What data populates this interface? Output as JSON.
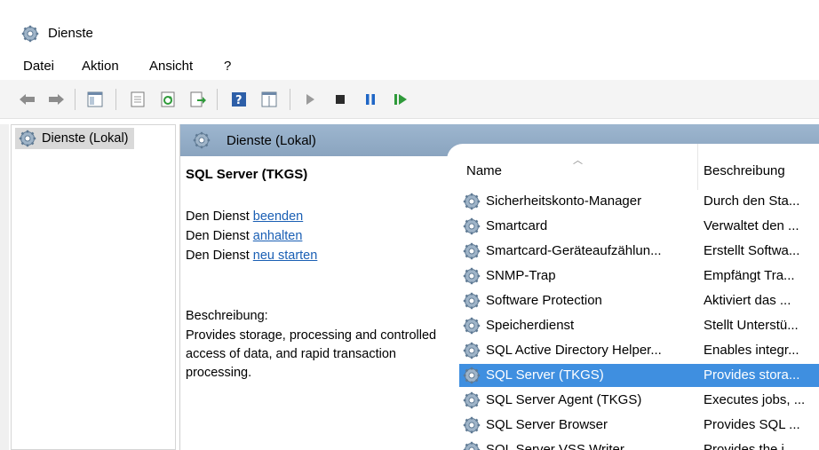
{
  "window": {
    "title": "Dienste"
  },
  "menu": [
    "Datei",
    "Aktion",
    "Ansicht",
    "?"
  ],
  "toolbar": {
    "icons": [
      "back-arrow-icon",
      "forward-arrow-icon",
      "show-hide-console-tree-icon",
      "properties-icon",
      "refresh-icon",
      "export-list-icon",
      "help-icon",
      "extended-view-icon",
      "start-service-icon",
      "stop-service-icon",
      "pause-service-icon",
      "resume-service-icon"
    ]
  },
  "tree": {
    "item": "Dienste (Lokal)"
  },
  "panel": {
    "header": "Dienste (Lokal)"
  },
  "detail": {
    "service_name": "SQL Server (TKGS)",
    "actions": [
      {
        "prefix": "Den Dienst ",
        "link": "beenden"
      },
      {
        "prefix": "Den Dienst ",
        "link": "anhalten"
      },
      {
        "prefix": "Den Dienst ",
        "link": "neu starten"
      }
    ],
    "description_label": "Beschreibung:",
    "description": "Provides storage, processing and controlled access of data, and rapid transaction processing."
  },
  "list": {
    "columns": {
      "name": "Name",
      "description": "Beschreibung"
    },
    "rows": [
      {
        "name": "Sicherheitskonto-Manager",
        "desc": "Durch den Sta..."
      },
      {
        "name": "Smartcard",
        "desc": "Verwaltet den ..."
      },
      {
        "name": "Smartcard-Geräteaufzählun...",
        "desc": "Erstellt Softwa..."
      },
      {
        "name": "SNMP-Trap",
        "desc": "Empfängt Tra..."
      },
      {
        "name": "Software Protection",
        "desc": "Aktiviert das ..."
      },
      {
        "name": "Speicherdienst",
        "desc": "Stellt Unterstü..."
      },
      {
        "name": "SQL Active Directory Helper...",
        "desc": "Enables integr..."
      },
      {
        "name": "SQL Server (TKGS)",
        "desc": "Provides stora...",
        "selected": true
      },
      {
        "name": "SQL Server Agent (TKGS)",
        "desc": "Executes jobs, ..."
      },
      {
        "name": "SQL Server Browser",
        "desc": "Provides SQL ..."
      },
      {
        "name": "SQL Server VSS Writer",
        "desc": "Provides the i..."
      }
    ]
  },
  "colors": {
    "selection": "#3f8fe0",
    "header": "#8fa9c4",
    "link": "#1a5fb4"
  }
}
